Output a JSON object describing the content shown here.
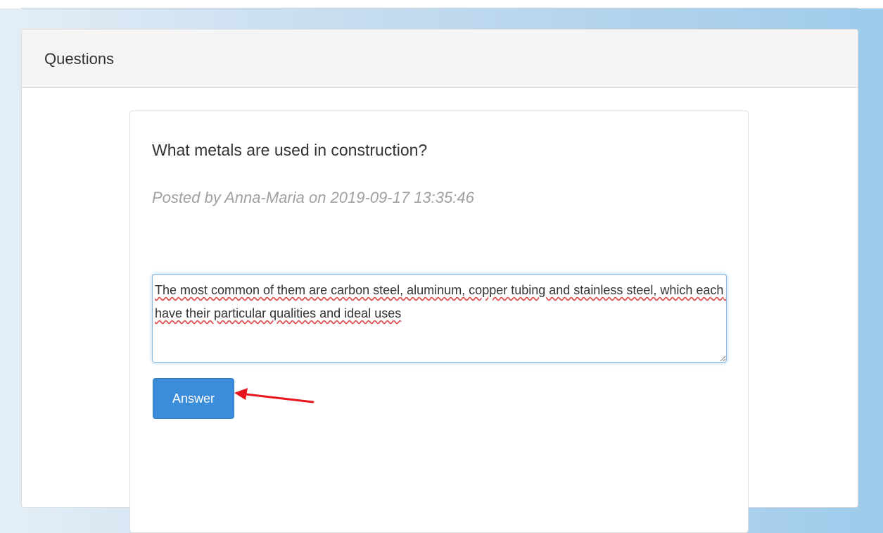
{
  "panel": {
    "heading": "Questions"
  },
  "question": {
    "title": "What metals are used in construction?",
    "meta": "Posted by Anna-Maria on 2019-09-17 13:35:46"
  },
  "answer_form": {
    "textarea_value": "The most common of them are carbon steel, aluminum, copper tubing and stainless steel, which each have their particular qualities and ideal uses",
    "submit_label": "Answer"
  },
  "annotation": {
    "arrow_color": "#e8161c"
  },
  "colors": {
    "button_primary": "#3b8dd9",
    "meta_text": "#a0a0a0",
    "panel_heading_bg": "#f5f5f5"
  }
}
